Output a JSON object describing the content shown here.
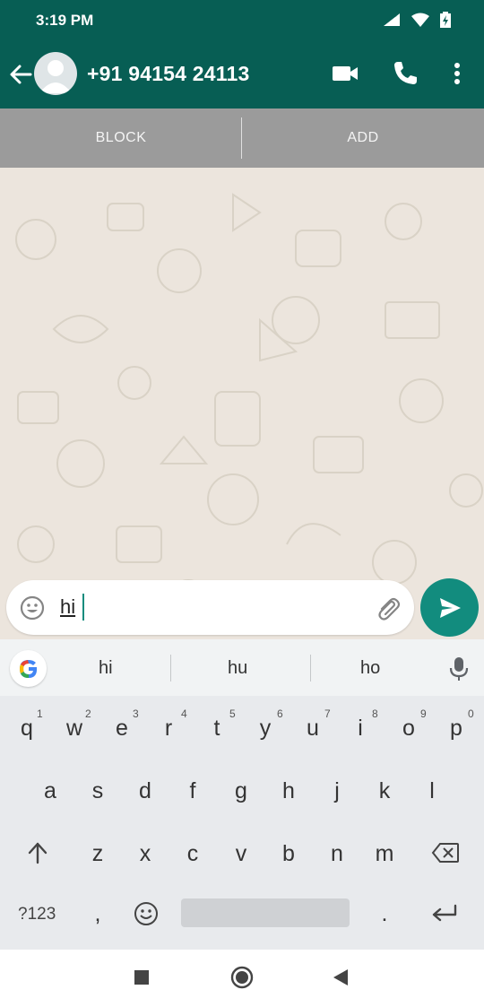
{
  "status_bar": {
    "time": "3:19 PM"
  },
  "chat_header": {
    "contact_name": "+91 94154 24113"
  },
  "action_bar": {
    "block_label": "BLOCK",
    "add_label": "ADD"
  },
  "composer": {
    "text": "hi"
  },
  "keyboard": {
    "suggestions": [
      "hi",
      "hu",
      "ho"
    ],
    "row1": [
      {
        "key": "q",
        "num": "1"
      },
      {
        "key": "w",
        "num": "2"
      },
      {
        "key": "e",
        "num": "3"
      },
      {
        "key": "r",
        "num": "4"
      },
      {
        "key": "t",
        "num": "5"
      },
      {
        "key": "y",
        "num": "6"
      },
      {
        "key": "u",
        "num": "7"
      },
      {
        "key": "i",
        "num": "8"
      },
      {
        "key": "o",
        "num": "9"
      },
      {
        "key": "p",
        "num": "0"
      }
    ],
    "row2": [
      "a",
      "s",
      "d",
      "f",
      "g",
      "h",
      "j",
      "k",
      "l"
    ],
    "row3": [
      "z",
      "x",
      "c",
      "v",
      "b",
      "n",
      "m"
    ],
    "symbols_label": "?123",
    "comma_label": ",",
    "period_label": "."
  },
  "colors": {
    "header_green": "#075e54",
    "accent_teal": "#128c7e",
    "chat_bg": "#ece5dd",
    "action_bar_gray": "#9b9b9b"
  }
}
